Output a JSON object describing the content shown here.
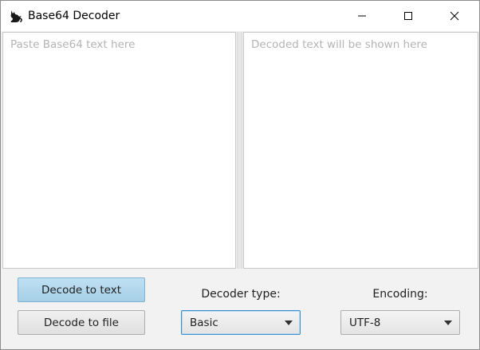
{
  "window": {
    "title": "Base64 Decoder"
  },
  "input": {
    "placeholder": "Paste Base64 text here",
    "value": ""
  },
  "output": {
    "placeholder": "Decoded text will be shown here",
    "value": ""
  },
  "buttons": {
    "decode_text": "Decode to text",
    "decode_file": "Decode to file"
  },
  "decoder_type": {
    "label": "Decoder type:",
    "selected": "Basic"
  },
  "encoding": {
    "label": "Encoding:",
    "selected": "UTF-8"
  },
  "icons": {
    "app": "cat-icon",
    "minimize": "minimize-icon",
    "maximize": "maximize-icon",
    "close": "close-icon",
    "dropdown": "chevron-down-icon"
  },
  "colors": {
    "primary_button": "#a6cfe6",
    "focus_border": "#3c8fcf",
    "background": "#f2f2f2"
  }
}
